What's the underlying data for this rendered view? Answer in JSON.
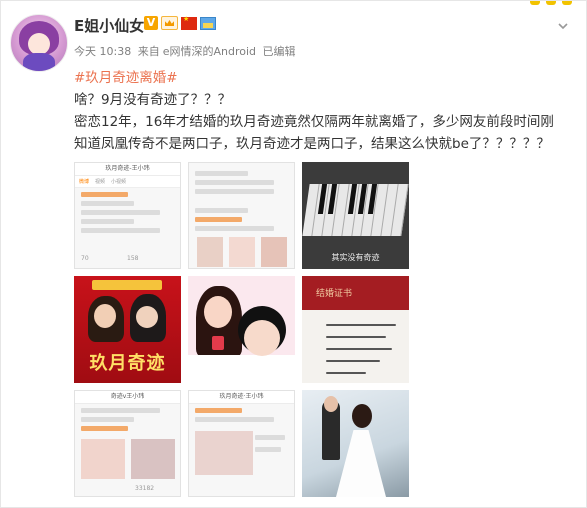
{
  "post": {
    "author_name": "E姐小仙女",
    "verified_mark": "V",
    "time": "今天 10:38",
    "source_prefix": "来自",
    "source": "e网情深的Android",
    "edited": "已编辑",
    "topic": "#玖月奇迹离婚#",
    "text_line_1": "啥？9月没有奇迹了？？？",
    "text_line_2": "密恋12年，16年才结婚的玖月奇迹竟然仅隔两年就离婚了，多少网友前段时间刚",
    "text_line_3": "知道凤凰传奇不是两口子，玖月奇迹才是两口子，结果这么快就be了？？？？？"
  },
  "images": [
    {
      "kind": "screenshot",
      "header": "玖月奇迹-王小玮",
      "tabs": [
        "微博",
        "视频",
        "小视频"
      ],
      "stats": [
        "70",
        "158"
      ]
    },
    {
      "kind": "screenshot",
      "header": "",
      "tabs": [],
      "stats": []
    },
    {
      "kind": "piano",
      "caption": "其实没有奇迹"
    },
    {
      "kind": "poster",
      "title": "玖月奇迹"
    },
    {
      "kind": "couple"
    },
    {
      "kind": "certificate",
      "header": "结婚证书"
    },
    {
      "kind": "screenshot",
      "header": "奇迹v王小玮",
      "tabs": [],
      "stats": [
        "33182"
      ]
    },
    {
      "kind": "screenshot",
      "header": "玖月奇迹·王小玮",
      "tabs": [],
      "stats": []
    },
    {
      "kind": "wedding"
    }
  ],
  "colors": {
    "topic": "#eb7350",
    "meta": "#808080",
    "text": "#333333",
    "verified": "#f7a500"
  },
  "icons": [
    "more-chevron-icon",
    "verified-v-icon",
    "vip-crown-icon",
    "china-flag-icon",
    "photo-badge-icon"
  ]
}
